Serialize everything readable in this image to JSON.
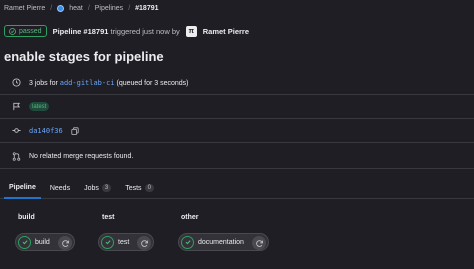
{
  "breadcrumb": {
    "items": [
      "Ramet Pierre",
      "heat",
      "Pipelines",
      "#18791"
    ]
  },
  "header": {
    "status_label": "passed",
    "pipeline_label": "Pipeline #18791",
    "triggered_text": "triggered just now by",
    "user_initials": "π",
    "user_name": "Ramet Pierre"
  },
  "title": "enable stages for pipeline",
  "info": {
    "jobs_prefix": "3 jobs for",
    "branch": "add-gitlab-ci",
    "queued_text": "(queued for 3 seconds)",
    "tag_label": "latest",
    "commit_sha": "da140f36",
    "merge_requests_text": "No related merge requests found."
  },
  "tabs": [
    {
      "label": "Pipeline",
      "active": true
    },
    {
      "label": "Needs"
    },
    {
      "label": "Jobs",
      "count": "3"
    },
    {
      "label": "Tests",
      "count": "0"
    }
  ],
  "stages": [
    {
      "name": "build",
      "job": "build"
    },
    {
      "name": "test",
      "job": "test"
    },
    {
      "name": "other",
      "job": "documentation"
    }
  ],
  "colors": {
    "success": "#2da160",
    "link": "#6aa7f8",
    "background": "#1f1e24"
  }
}
